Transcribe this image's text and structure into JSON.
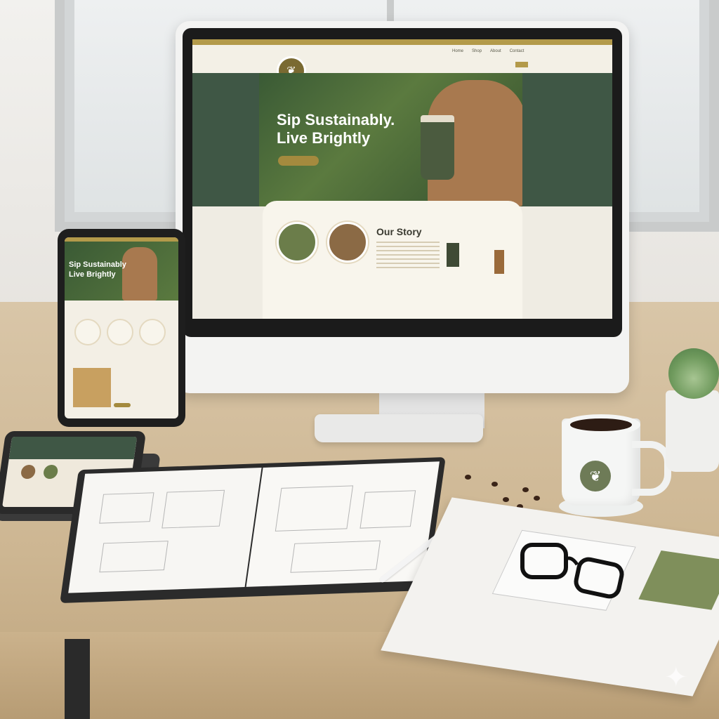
{
  "website": {
    "nav_links": [
      "Home",
      "Shop",
      "About",
      "Contact"
    ],
    "hero_title_line1": "Sip Sustainably.",
    "hero_title_line2": "Live Brightly",
    "section_heading": "Our Story"
  },
  "phone_site": {
    "hero_title_line1": "Sip Sustainably",
    "hero_title_line2": "Live Brightly"
  },
  "colors": {
    "forest_green": "#3f5745",
    "gold_accent": "#b39a4a",
    "cream": "#f3efe5",
    "coffee": "#2d1c14"
  },
  "icons": {
    "logo": "leaf-icon",
    "mug_logo": "leaf-icon",
    "sparkle": "sparkle-icon"
  }
}
